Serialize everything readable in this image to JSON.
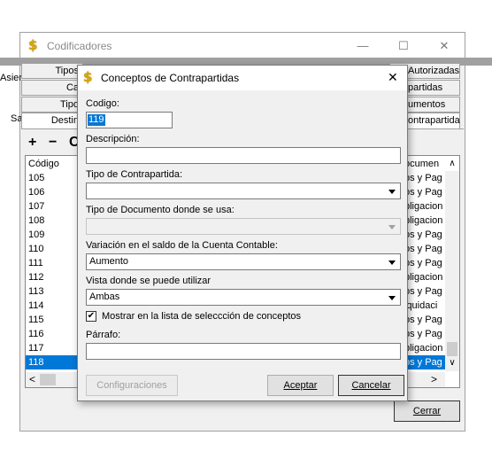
{
  "outer_window": {
    "title": "Codificadores",
    "minimize": "—",
    "maximize": "☐",
    "close": "✕",
    "left_fragments": {
      "asie": "Asier",
      "sa": "Sa"
    },
    "tabs_left": [
      "Tipos",
      "Ca",
      "Tipo",
      "Destin"
    ],
    "tabs_right": [
      "Autorizadas",
      "partidas",
      "umentos",
      "ontrapartida"
    ],
    "toolbar": {
      "add": "+",
      "remove": "−",
      "other": "C"
    },
    "list": {
      "header": "Código",
      "header_right": "ocumen",
      "rows": [
        {
          "code": "105",
          "right": "os y Pag",
          "selected": false
        },
        {
          "code": "106",
          "right": "os y Pag",
          "selected": false
        },
        {
          "code": "107",
          "right": "bligacion",
          "selected": false
        },
        {
          "code": "108",
          "right": "bligacion",
          "selected": false
        },
        {
          "code": "109",
          "right": "os y Pag",
          "selected": false
        },
        {
          "code": "110",
          "right": "os y Pag",
          "selected": false
        },
        {
          "code": "111",
          "right": "os y Pag",
          "selected": false
        },
        {
          "code": "112",
          "right": "bligacion",
          "selected": false
        },
        {
          "code": "113",
          "right": "os y Pag",
          "selected": false
        },
        {
          "code": "114",
          "right": "iquidaci",
          "selected": false
        },
        {
          "code": "115",
          "right": "os y Pag",
          "selected": false
        },
        {
          "code": "116",
          "right": "os y Pag",
          "selected": false
        },
        {
          "code": "117",
          "right": "bligacion",
          "selected": false
        },
        {
          "code": "118",
          "right": "os y Pag",
          "selected": true
        }
      ]
    },
    "close_button": "Cerrar"
  },
  "dialog": {
    "title": "Conceptos de Contrapartidas",
    "close": "✕",
    "codigo_label": "Codigo:",
    "codigo_value": "119",
    "descripcion_label": "Descripción:",
    "descripcion_value": "",
    "tipo_contrapartida_label": "Tipo de Contrapartida:",
    "tipo_contrapartida_value": "",
    "tipo_documento_label": "Tipo de Documento donde se usa:",
    "tipo_documento_value": "",
    "variacion_label": "Variación en el saldo de la  Cuenta Contable:",
    "variacion_value": "Aumento",
    "vista_label": "Vista donde se puede utilizar",
    "vista_value": "Ambas",
    "mostrar_checkbox_label": "Mostrar en la lista de seleccción de conceptos",
    "mostrar_checked": "✔",
    "parrafo_label": "Párrafo:",
    "parrafo_value": "",
    "configuraciones_button": "Configuraciones",
    "aceptar_button": "Aceptar",
    "cancelar_button": "Cancelar"
  }
}
